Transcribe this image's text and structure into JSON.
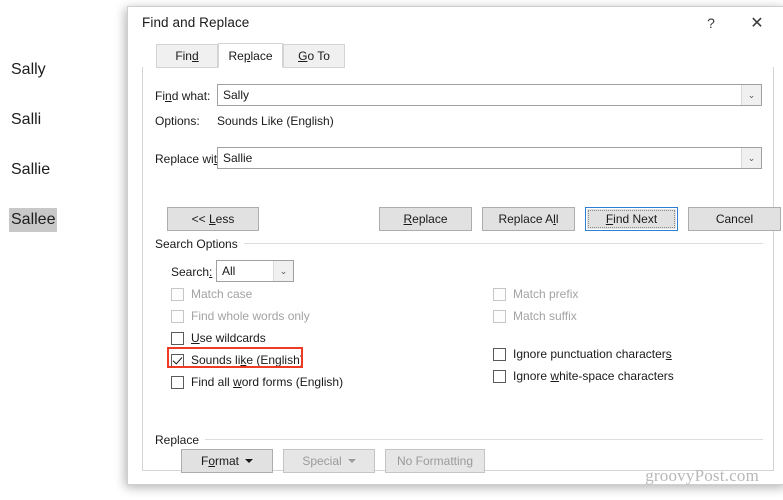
{
  "document": {
    "lines": [
      {
        "text": "Sally",
        "selected": false
      },
      {
        "text": "Salli",
        "selected": false
      },
      {
        "text": "Sallie",
        "selected": false
      },
      {
        "text": "Sallee",
        "selected": true
      }
    ]
  },
  "dialog": {
    "title": "Find and Replace",
    "help_glyph": "?",
    "close_glyph": "✕",
    "tabs": [
      {
        "label": "Find",
        "active": false
      },
      {
        "label": "Replace",
        "active": true
      },
      {
        "label": "Go To",
        "active": false
      }
    ],
    "fields": {
      "find_what_label": "Find what:",
      "find_what_value": "Sally",
      "options_label": "Options:",
      "options_value": "Sounds Like (English)",
      "replace_with_label": "Replace with:",
      "replace_with_value": "Sallie",
      "dropdown_glyph": "⌄"
    },
    "buttons": {
      "less": "<< Less",
      "replace": "Replace",
      "replace_all": "Replace All",
      "find_next": "Find Next",
      "cancel": "Cancel"
    },
    "search_options": {
      "group_title": "Search Options",
      "search_label": "Search:",
      "search_value": "All",
      "left_checkboxes": [
        {
          "label": "Match case",
          "checked": false,
          "enabled": false
        },
        {
          "label": "Find whole words only",
          "checked": false,
          "enabled": false
        },
        {
          "label": "Use wildcards",
          "checked": false,
          "enabled": true
        },
        {
          "label": "Sounds like (English)",
          "checked": true,
          "enabled": true
        },
        {
          "label": "Find all word forms (English)",
          "checked": false,
          "enabled": true
        }
      ],
      "right_checkboxes": [
        {
          "label": "Match prefix",
          "checked": false,
          "enabled": false
        },
        {
          "label": "Match suffix",
          "checked": false,
          "enabled": false
        },
        {
          "label": "Ignore punctuation characters",
          "checked": false,
          "enabled": true
        },
        {
          "label": "Ignore white-space characters",
          "checked": false,
          "enabled": true
        }
      ],
      "highlight_color": "#ee3b25",
      "highlighted_option": "Sounds like (English)"
    },
    "replace_section": {
      "group_title": "Replace",
      "format_button": "Format",
      "special_button": "Special",
      "no_formatting_button": "No Formatting"
    }
  },
  "watermark": {
    "text": "groovyPost.com"
  }
}
